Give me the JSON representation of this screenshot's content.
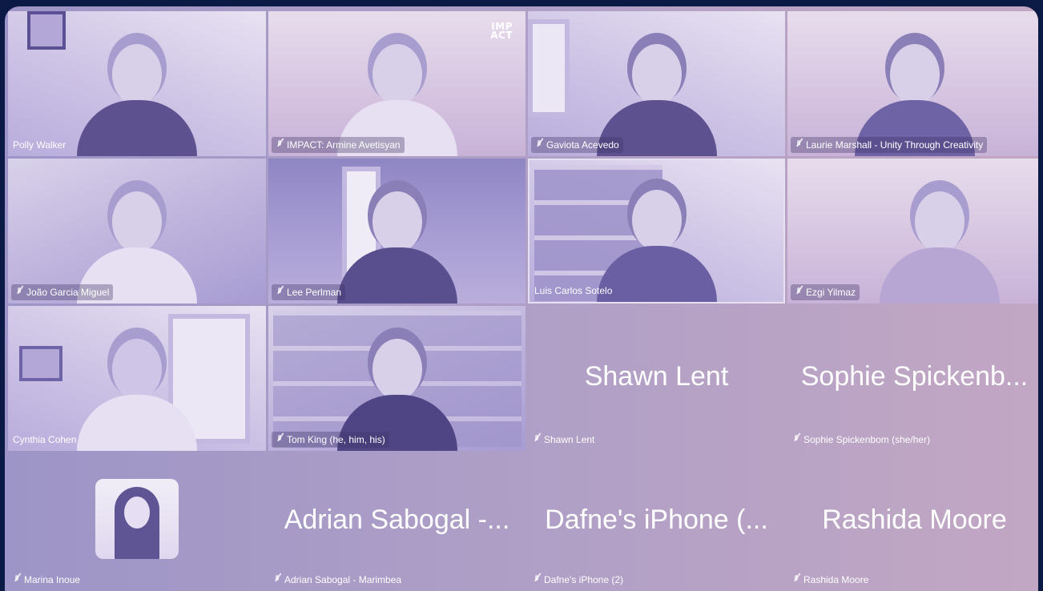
{
  "colors": {
    "background": "#0b1a45",
    "tile_overlay": "#ad9ec6",
    "label_text": "#ffffff"
  },
  "participants": [
    {
      "label": "Polly Walker",
      "big_name": null,
      "has_video": true,
      "muted": false
    },
    {
      "label": "IMPACT: Armine Avetisyan",
      "big_name": null,
      "has_video": true,
      "muted": true
    },
    {
      "label": "Gaviota Acevedo",
      "big_name": null,
      "has_video": true,
      "muted": true
    },
    {
      "label": "Laurie Marshall - Unity Through Creativity",
      "big_name": null,
      "has_video": true,
      "muted": true
    },
    {
      "label": "João Garcia Miguel",
      "big_name": null,
      "has_video": true,
      "muted": true
    },
    {
      "label": "Lee Perlman",
      "big_name": null,
      "has_video": true,
      "muted": true
    },
    {
      "label": "Luis Carlos Sotelo",
      "big_name": null,
      "has_video": true,
      "muted": false,
      "active_speaker": true
    },
    {
      "label": "Ezgi Yilmaz",
      "big_name": null,
      "has_video": true,
      "muted": true
    },
    {
      "label": "Cynthia Cohen",
      "big_name": null,
      "has_video": true,
      "muted": false
    },
    {
      "label": "Tom King (he, him, his)",
      "big_name": null,
      "has_video": true,
      "muted": true
    },
    {
      "label": "Shawn Lent",
      "big_name": "Shawn Lent",
      "has_video": false,
      "muted": true
    },
    {
      "label": "Sophie Spickenbom (she/her)",
      "big_name": "Sophie Spickenb...",
      "has_video": false,
      "muted": true
    },
    {
      "label": "Marina Inoue",
      "big_name": null,
      "has_video": false,
      "has_avatar": true,
      "muted": true
    },
    {
      "label": "Adrian Sabogal - Marimbea",
      "big_name": "Adrian Sabogal -...",
      "has_video": false,
      "muted": true
    },
    {
      "label": "Dafne's iPhone (2)",
      "big_name": "Dafne's iPhone (...",
      "has_video": false,
      "muted": true
    },
    {
      "label": "Rashida Moore",
      "big_name": "Rashida Moore",
      "has_video": false,
      "muted": true
    }
  ],
  "impact_logo": {
    "line1": "IMP",
    "line2": "ACT"
  }
}
